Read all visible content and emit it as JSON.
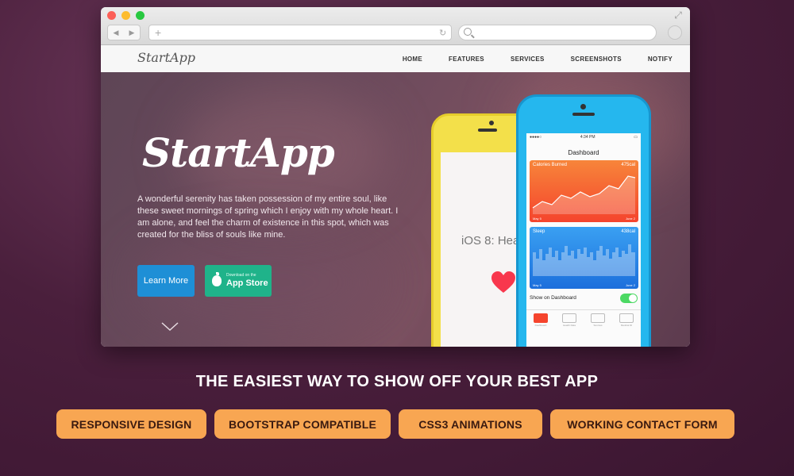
{
  "browser": {
    "address_value": "",
    "search_value": ""
  },
  "site": {
    "logo": "StartApp",
    "menu": [
      "HOME",
      "FEATURES",
      "SERVICES",
      "SCREENSHOTS",
      "NOTIFY"
    ]
  },
  "hero": {
    "title": "StartApp",
    "text": "A wonderful serenity has taken possession of my entire soul, like these sweet mornings of spring which I enjoy with my whole heart. I am alone, and feel the charm of existence in this spot, which was created for the bliss of souls like mine.",
    "learn_more": "Learn More",
    "store_small": "Download on the",
    "store_big": "App Store"
  },
  "phones": {
    "yellow_screen_text": "iOS 8: Hea",
    "blue": {
      "time": "4:34 PM",
      "title": "Dashboard",
      "calories_label": "Calories Burned",
      "calories_value": "475cal",
      "sleep_label": "Sleep",
      "sleep_value": "438cal",
      "date_start": "May 5",
      "date_end": "June 2",
      "show_label": "Show on Dashboard",
      "tabs": [
        "Dashboard",
        "Health Data",
        "Sources",
        "Medical ID"
      ]
    }
  },
  "tagline": "THE EASIEST WAY TO SHOW OFF YOUR BEST APP",
  "features": [
    "RESPONSIVE DESIGN",
    "BOOTSTRAP COMPATIBLE",
    "CSS3 ANIMATIONS",
    "WORKING CONTACT FORM"
  ],
  "colors": {
    "accent_orange": "#f8a652",
    "learn_blue": "#1e8fd6",
    "store_green": "#1fb38a"
  }
}
